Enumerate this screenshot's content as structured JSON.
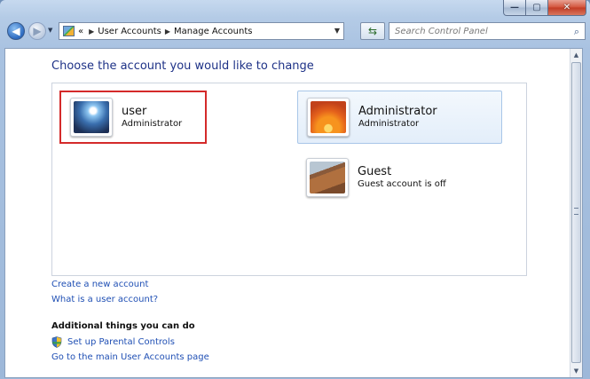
{
  "address": {
    "overflow": "«",
    "crumbs": [
      "User Accounts",
      "Manage Accounts"
    ]
  },
  "search": {
    "placeholder": "Search Control Panel"
  },
  "content": {
    "title": "Choose the account you would like to change",
    "accounts": [
      {
        "name": "user",
        "type": "Administrator",
        "selected": true
      },
      {
        "name": "Administrator",
        "type": "Administrator",
        "highlighted": true
      },
      {
        "name": "Guest",
        "type": "Guest account is off"
      }
    ],
    "links": {
      "create_account": "Create a new account",
      "what_is_account": "What is a user account?"
    },
    "additional": {
      "heading": "Additional things you can do",
      "parental_controls": "Set up Parental Controls",
      "main_page": "Go to the main User Accounts page"
    }
  },
  "colors": {
    "selection_border": "#d42a2a",
    "link": "#1f4fb4",
    "title": "#1e3287"
  }
}
